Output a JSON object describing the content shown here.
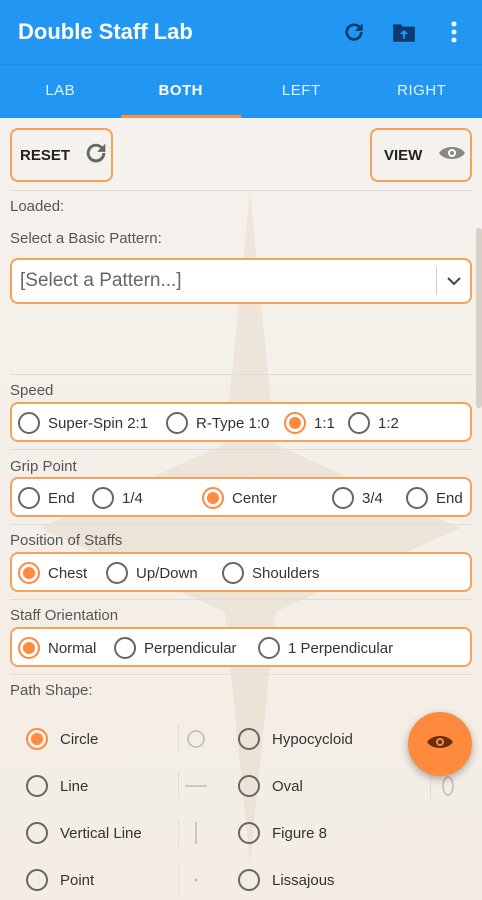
{
  "app": {
    "title": "Double Staff Lab"
  },
  "toolbar": {
    "icons": [
      "refresh-icon",
      "folder-upload-icon",
      "more-vert-icon"
    ]
  },
  "tabs": [
    {
      "label": "LAB",
      "active": false
    },
    {
      "label": "BOTH",
      "active": true
    },
    {
      "label": "LEFT",
      "active": false
    },
    {
      "label": "RIGHT",
      "active": false
    }
  ],
  "actions": {
    "reset_label": "RESET",
    "view_label": "VIEW"
  },
  "loaded_label": "Loaded:",
  "pattern": {
    "label": "Select a Basic Pattern:",
    "selected": "[Select a Pattern...]"
  },
  "speed": {
    "label": "Speed",
    "options": [
      "Super-Spin 2:1",
      "R-Type 1:0",
      "1:1",
      "1:2"
    ],
    "selected": "1:1"
  },
  "grip": {
    "label": "Grip Point",
    "options": [
      "End",
      "1/4",
      "Center",
      "3/4",
      "End"
    ],
    "selected": "Center"
  },
  "position": {
    "label": "Position of Staffs",
    "options": [
      "Chest",
      "Up/Down",
      "Shoulders"
    ],
    "selected": "Chest"
  },
  "orientation": {
    "label": "Staff Orientation",
    "options": [
      "Normal",
      "Perpendicular",
      "1 Perpendicular"
    ],
    "selected": "Normal"
  },
  "path": {
    "label": "Path Shape:",
    "left": [
      "Circle",
      "Line",
      "Vertical Line",
      "Point"
    ],
    "right": [
      "Hypocycloid",
      "Oval",
      "Figure 8",
      "Lissajous"
    ],
    "selected": "Circle"
  },
  "colors": {
    "primary": "#2196f3",
    "accent": "#ff8a3d",
    "outline": "#f5a25a"
  }
}
